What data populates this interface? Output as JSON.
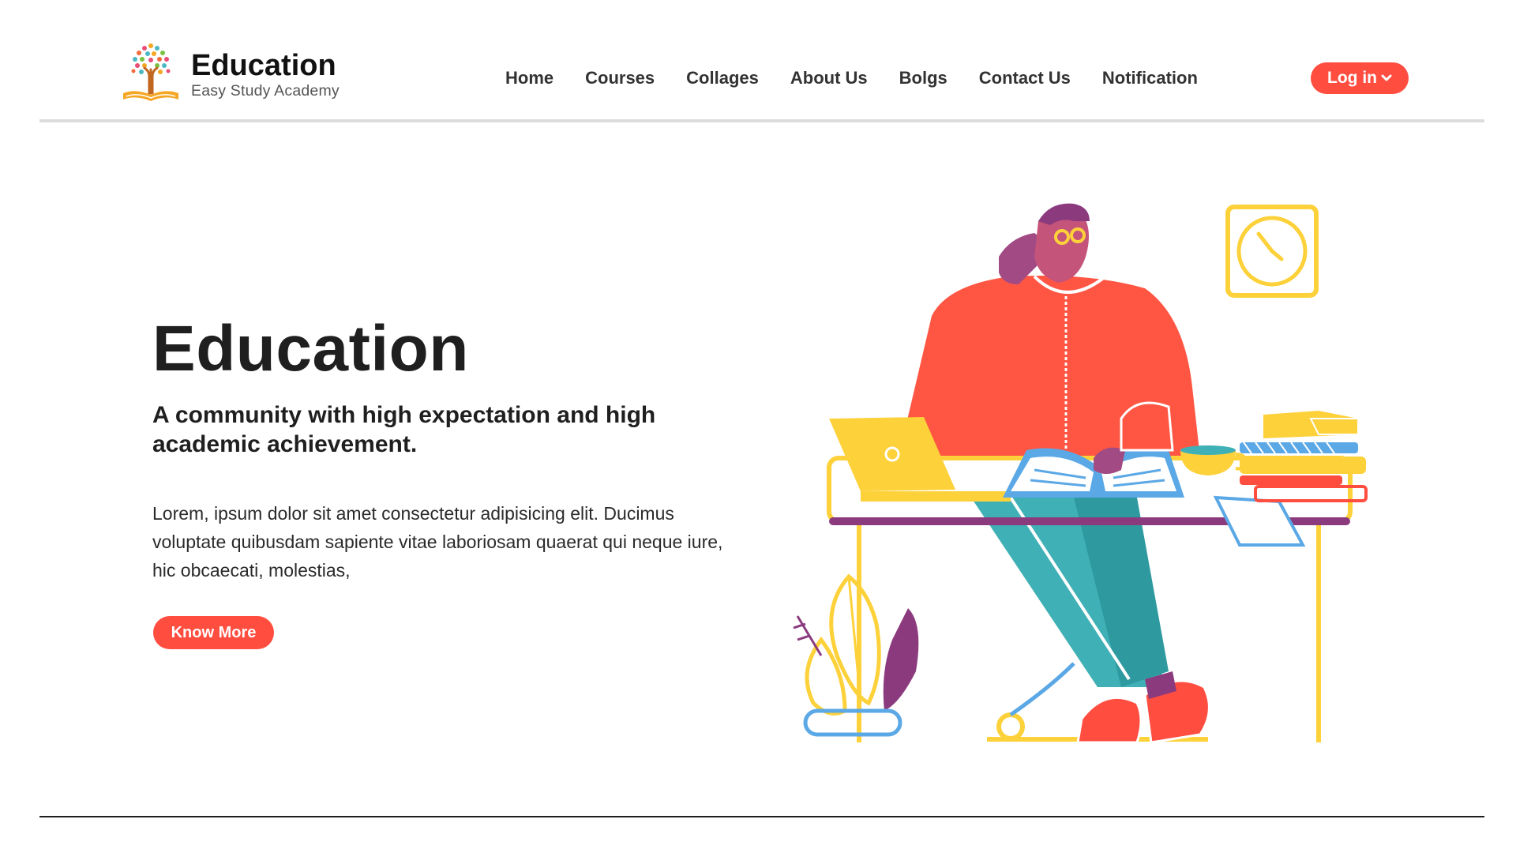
{
  "brand": {
    "title": "Education",
    "subtitle": "Easy Study Academy",
    "logo_icon": "tree-book-logo-icon"
  },
  "nav": {
    "items": [
      {
        "label": "Home"
      },
      {
        "label": "Courses"
      },
      {
        "label": "Collages"
      },
      {
        "label": "About Us"
      },
      {
        "label": "Bolgs"
      },
      {
        "label": "Contact Us"
      },
      {
        "label": "Notification"
      }
    ]
  },
  "login": {
    "label": "Log in",
    "icon": "chevron-down-icon"
  },
  "hero": {
    "title": "Education",
    "subtitle": "A community with high expectation and high academic achievement.",
    "body": "Lorem, ipsum dolor sit amet consectetur adipisicing elit. Ducimus voluptate quibusdam sapiente vitae laboriosam quaerat qui neque iure, hic obcaecati, molestias,",
    "cta_label": "Know More",
    "illustration_icon": "student-studying-illustration"
  },
  "colors": {
    "accent": "#ff4d40",
    "yellow": "#fdd13a",
    "teal": "#3fb0b5",
    "blue": "#5ba8e6",
    "purple": "#8c3a7e",
    "text": "#1f1f1f"
  }
}
